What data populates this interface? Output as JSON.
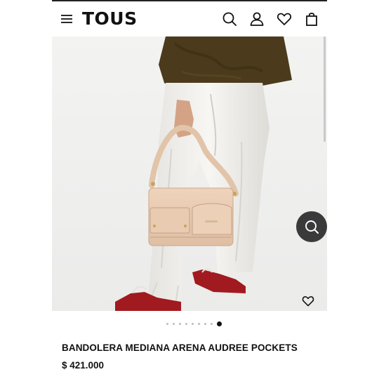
{
  "header": {
    "logo": "TOUS",
    "icons": [
      "menu-icon",
      "search-icon",
      "user-icon",
      "heart-icon",
      "bag-icon"
    ]
  },
  "gallery": {
    "slide_count": 9,
    "active_index": 8,
    "image": "bag-photo"
  },
  "product": {
    "title": "BANDOLERA MEDIANA ARENA AUDREE POCKETS",
    "price": "$ 421.000"
  },
  "colors": {
    "text": "#111111",
    "fab": "#3a3a3a",
    "bag": "#e8c9ae",
    "jeans": "#f2f1ee",
    "jacket": "#4a3a1d",
    "shoes": "#a11a1f"
  }
}
